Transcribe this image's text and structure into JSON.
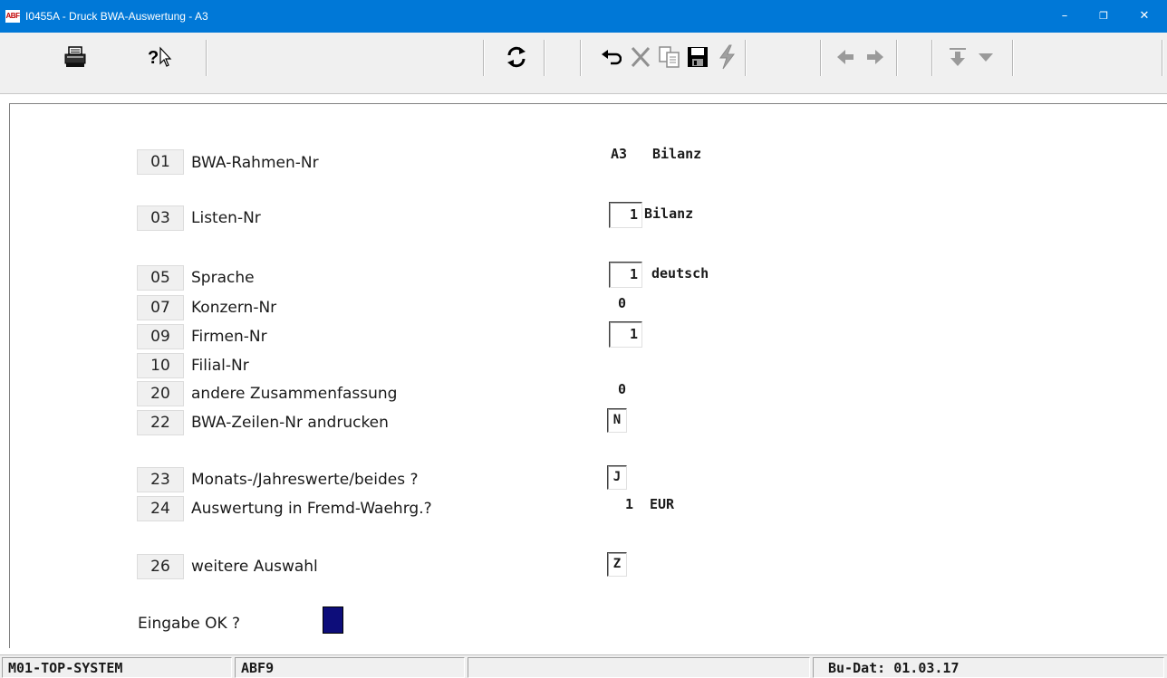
{
  "window": {
    "icon_text": "ABF",
    "title": "I0455A  - Druck BWA-Auswertung - A3",
    "minimize": "–",
    "maximize": "❐",
    "close": "✕"
  },
  "toolbar": {
    "buttons": [
      {
        "name": "print-icon"
      },
      {
        "name": "context-help-icon",
        "label": "?"
      },
      {
        "name": "refresh-icon"
      },
      {
        "name": "undo-icon"
      },
      {
        "name": "delete-icon"
      },
      {
        "name": "copy-icon"
      },
      {
        "name": "save-icon"
      },
      {
        "name": "lightning-icon"
      },
      {
        "name": "arrow-left-icon"
      },
      {
        "name": "arrow-right-icon"
      },
      {
        "name": "arrow-down-icon"
      },
      {
        "name": "dropdown-icon"
      }
    ]
  },
  "form": {
    "fields": [
      {
        "num": "01",
        "label": "BWA-Rahmen-Nr",
        "value": "A3",
        "desc": "Bilanz"
      },
      {
        "num": "03",
        "label": "Listen-Nr",
        "value": "1",
        "desc": "Bilanz"
      },
      {
        "num": "05",
        "label": "Sprache",
        "value": "1",
        "desc": "deutsch"
      },
      {
        "num": "07",
        "label": "Konzern-Nr",
        "value": "0"
      },
      {
        "num": "09",
        "label": "Firmen-Nr",
        "value": "1"
      },
      {
        "num": "10",
        "label": "Filial-Nr"
      },
      {
        "num": "20",
        "label": "andere Zusammenfassung",
        "value": "0"
      },
      {
        "num": "22",
        "label": "BWA-Zeilen-Nr andrucken",
        "value": "N"
      },
      {
        "num": "23",
        "label": "Monats-/Jahreswerte/beides ?",
        "value": "J"
      },
      {
        "num": "24",
        "label": "Auswertung in Fremd-Waehrg.?",
        "value": "1",
        "desc": "EUR"
      },
      {
        "num": "26",
        "label": "weitere Auswahl",
        "value": "Z"
      }
    ],
    "prompt": "Eingabe OK ?"
  },
  "status": {
    "system": "M01-TOP-SYSTEM",
    "user": "ABF9",
    "middle": "",
    "date": "Bu-Dat: 01.03.17"
  },
  "colors": {
    "titlebar": "#0078d7",
    "cursor_field": "#0d0d7a",
    "toolbar_bg": "#f0f0f0"
  }
}
